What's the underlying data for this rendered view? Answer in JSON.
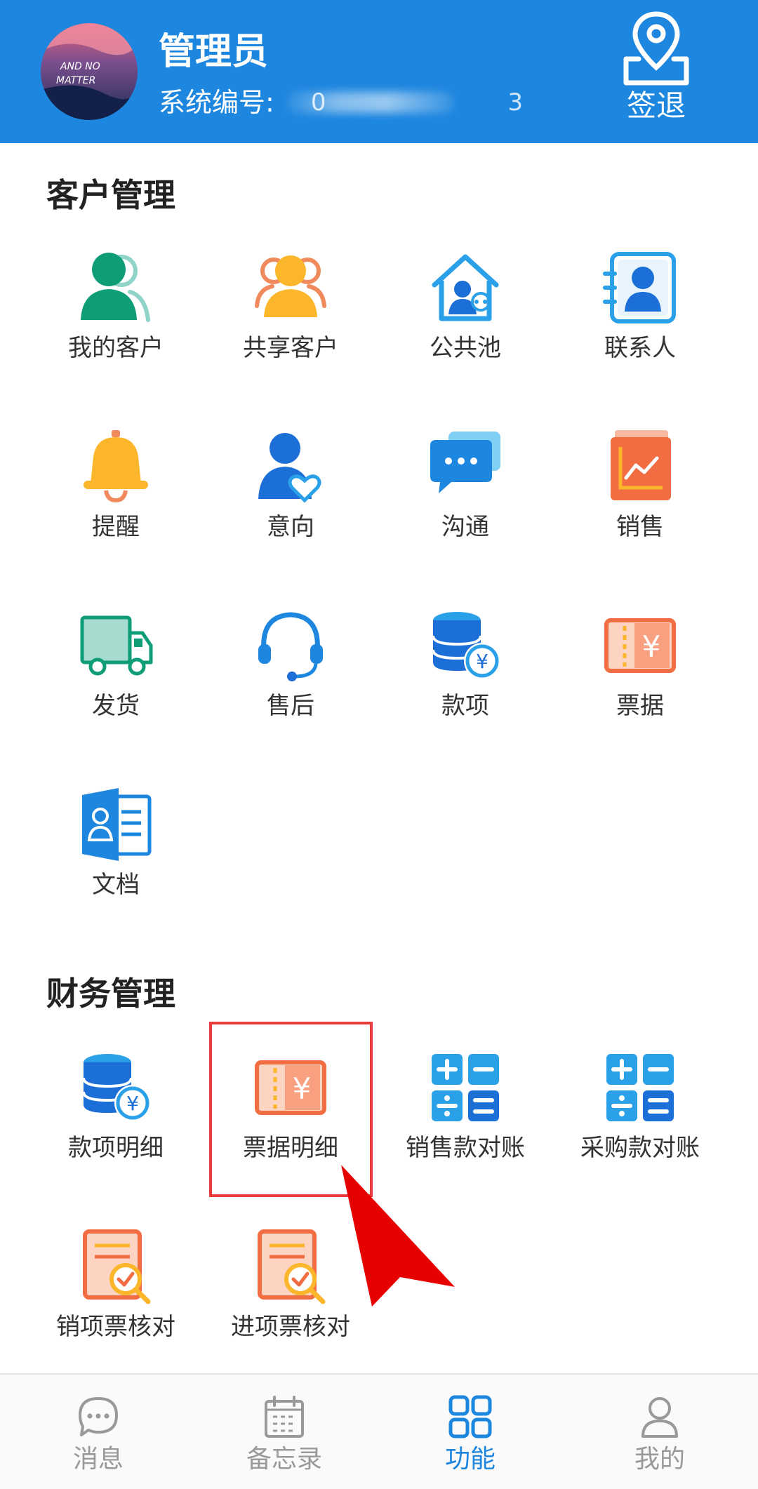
{
  "header": {
    "avatar_text": [
      "AND NO",
      "MATTER"
    ],
    "admin_name": "管理员",
    "system_number_label": "系统编号:",
    "system_number_value": "0    3",
    "signout_label": "签退"
  },
  "customer_section": {
    "title": "客户管理",
    "items": [
      {
        "label": "我的客户",
        "icon": "my-customers-icon"
      },
      {
        "label": "共享客户",
        "icon": "shared-customers-icon"
      },
      {
        "label": "公共池",
        "icon": "public-pool-icon"
      },
      {
        "label": "联系人",
        "icon": "contacts-icon"
      },
      {
        "label": "提醒",
        "icon": "bell-icon"
      },
      {
        "label": "意向",
        "icon": "intention-icon"
      },
      {
        "label": "沟通",
        "icon": "chat-icon"
      },
      {
        "label": "销售",
        "icon": "sales-chart-icon"
      },
      {
        "label": "发货",
        "icon": "truck-icon"
      },
      {
        "label": "售后",
        "icon": "headset-icon"
      },
      {
        "label": "款项",
        "icon": "coins-icon"
      },
      {
        "label": "票据",
        "icon": "ticket-icon"
      },
      {
        "label": "文档",
        "icon": "document-icon"
      }
    ]
  },
  "finance_section": {
    "title": "财务管理",
    "items": [
      {
        "label": "款项明细",
        "icon": "coins-icon"
      },
      {
        "label": "票据明细",
        "icon": "ticket-icon"
      },
      {
        "label": "销售款对账",
        "icon": "calculator-icon"
      },
      {
        "label": "采购款对账",
        "icon": "calculator-icon"
      },
      {
        "label": "销项票核对",
        "icon": "invoice-check-icon"
      },
      {
        "label": "进项票核对",
        "icon": "invoice-check-icon"
      }
    ]
  },
  "bottom_nav": {
    "items": [
      {
        "label": "消息",
        "icon": "message-icon"
      },
      {
        "label": "备忘录",
        "icon": "calendar-icon"
      },
      {
        "label": "功能",
        "icon": "grid-icon"
      },
      {
        "label": "我的",
        "icon": "user-icon"
      }
    ],
    "active": "功能"
  },
  "colors": {
    "header_bg": "#1d86df",
    "active_nav": "#1d86df",
    "highlight": "#e93b3b",
    "cursor": "#e60000"
  }
}
